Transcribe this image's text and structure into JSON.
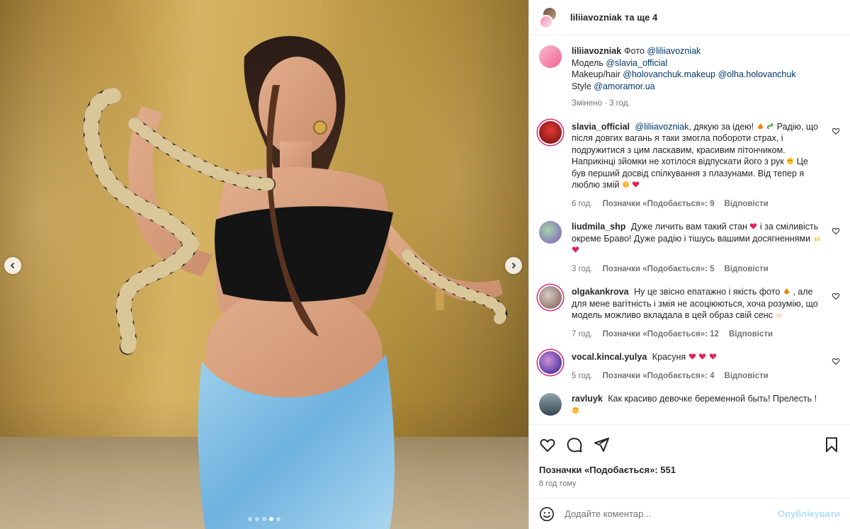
{
  "header": {
    "owner": "liliiavozniak",
    "owner_extra": "та ще 4"
  },
  "caption": {
    "username": "liliiavozniak",
    "line1_text": "Фото",
    "line1_mention": "@liliiavozniak",
    "line2_text": "Модель",
    "line2_mention": "@slavia_official",
    "line3_text": "Makeup/hair",
    "line3_mention_a": "@holovanchuk.makeup",
    "line3_mention_b": "@olha.holovanchuk",
    "line4_text": "Style",
    "line4_mention": "@amoramor.ua",
    "meta": "Змінено · 3 год."
  },
  "comments": [
    {
      "username": "slavia_official",
      "mention": "@liliiavozniak",
      "text_a": ", дякую за ідею!",
      "text_b": "Радію, що після довгих вагань я таки змогла побороти страх, і подружитися з цим ласкавим, красивим пітончиком. Наприкінці зйомки не хотілося відпускати його з рук",
      "text_c": "Це був перший досвід спілкування з плазунами. Від тепер я люблю змій",
      "time": "6 год.",
      "likes": "Позначки «Подобається»: 9",
      "reply": "Відповісти"
    },
    {
      "username": "liudmila_shp",
      "text_a": "Дуже личить вам такий стан",
      "text_b": "і за сміливість окреме Браво! Дуже радію і тішусь вашими досягненнями",
      "time": "3 год.",
      "likes": "Позначки «Подобається»: 5",
      "reply": "Відповісти"
    },
    {
      "username": "olgakankrova",
      "text_a": "Ну це звісно епатажно і якість фото",
      "text_b": ", але для мене вагітність і змія не асоціюються, хоча розумію, що модель можливо вкладала в цей образ свій сенс",
      "time": "7 год.",
      "likes": "Позначки «Подобається»: 12",
      "reply": "Відповісти"
    },
    {
      "username": "vocal.kincal.yulya",
      "text_a": "Красуня",
      "time": "5 год.",
      "likes": "Позначки «Подобається»: 4",
      "reply": "Відповісти"
    },
    {
      "username": "ravluyk",
      "text_a": "Как красиво девочке беременной быть! Прелесть !"
    }
  ],
  "actions": {
    "likes": "Позначки «Подобається»: 551",
    "posted": "8 год тому"
  },
  "comment_box": {
    "placeholder": "Додайте коментар...",
    "publish": "Опублікувати"
  },
  "carousel": {
    "slide_count": 5,
    "active_index": 3
  },
  "colors": {
    "mention": "#00376b",
    "publish_disabled": "#b2dffc",
    "story_ring": "#d62976",
    "heart_red": "#e0245e"
  }
}
